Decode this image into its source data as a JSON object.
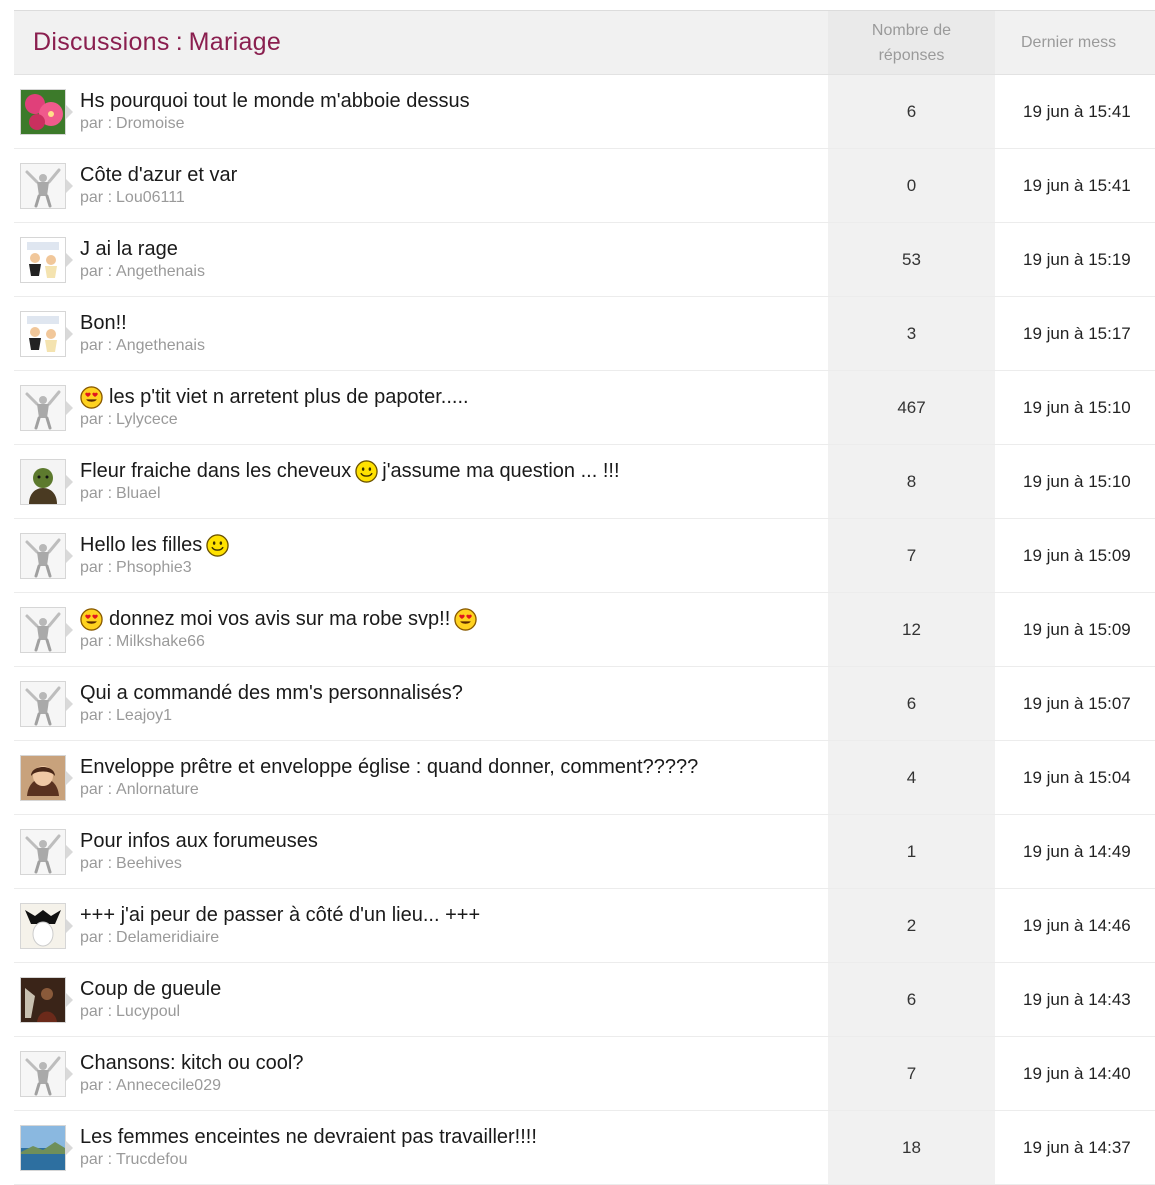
{
  "header": {
    "title_part1": "Discussions",
    "title_sep": ":",
    "title_part2": "Mariage",
    "replies_line1": "Nombre de",
    "replies_line2": "réponses",
    "last_label": "Dernier mess"
  },
  "author_prefix": "par :",
  "colors": {
    "title": "#8a1f4f",
    "muted": "#9a9a9a",
    "header_bg": "#f1f1f1"
  },
  "rows": [
    {
      "avatar": "pink-flower-avatar",
      "lead_emoji": null,
      "title": "Hs pourquoi tout le monde m'abboie dessus",
      "mid_emoji": null,
      "title_after": "",
      "end_emoji": null,
      "author": "Dromoise",
      "replies": "6",
      "last": "19 jun à 15:41"
    },
    {
      "avatar": "default-silhouette-avatar",
      "lead_emoji": null,
      "title": "Côte d'azur et var",
      "mid_emoji": null,
      "title_after": "",
      "end_emoji": null,
      "author": "Lou06111",
      "replies": "0",
      "last": "19 jun à 15:41"
    },
    {
      "avatar": "cartoon-couple-avatar",
      "lead_emoji": null,
      "title": "J ai la rage",
      "mid_emoji": null,
      "title_after": "",
      "end_emoji": null,
      "author": "Angethenais",
      "replies": "53",
      "last": "19 jun à 15:19"
    },
    {
      "avatar": "cartoon-couple-avatar",
      "lead_emoji": null,
      "title": "Bon!!",
      "mid_emoji": null,
      "title_after": "",
      "end_emoji": null,
      "author": "Angethenais",
      "replies": "3",
      "last": "19 jun à 15:17"
    },
    {
      "avatar": "default-silhouette-avatar",
      "lead_emoji": "heart-eyes",
      "title": "les p'tit viet n arretent plus de papoter.....",
      "mid_emoji": null,
      "title_after": "",
      "end_emoji": null,
      "author": "Lylycece",
      "replies": "467",
      "last": "19 jun à 15:10"
    },
    {
      "avatar": "green-ogre-avatar",
      "lead_emoji": null,
      "title": "Fleur fraiche dans les cheveux",
      "mid_emoji": "smile",
      "title_after": "j'assume ma question ... !!!",
      "end_emoji": null,
      "author": "Bluael",
      "replies": "8",
      "last": "19 jun à 15:10"
    },
    {
      "avatar": "default-silhouette-avatar",
      "lead_emoji": null,
      "title": "Hello les filles",
      "mid_emoji": null,
      "title_after": "",
      "end_emoji": "smile",
      "author": "Phsophie3",
      "replies": "7",
      "last": "19 jun à 15:09"
    },
    {
      "avatar": "default-silhouette-avatar",
      "lead_emoji": "heart-eyes",
      "title": "donnez moi vos avis sur ma robe svp!!",
      "mid_emoji": null,
      "title_after": "",
      "end_emoji": "heart-eyes",
      "author": "Milkshake66",
      "replies": "12",
      "last": "19 jun à 15:09"
    },
    {
      "avatar": "default-silhouette-avatar",
      "lead_emoji": null,
      "title": "Qui a commandé des mm's personnalisés?",
      "mid_emoji": null,
      "title_after": "",
      "end_emoji": null,
      "author": "Leajoy1",
      "replies": "6",
      "last": "19 jun à 15:07"
    },
    {
      "avatar": "woman-portrait-avatar",
      "lead_emoji": null,
      "title": "Enveloppe prêtre et enveloppe église : quand donner, comment?????",
      "mid_emoji": null,
      "title_after": "",
      "end_emoji": null,
      "author": "Anlornature",
      "replies": "4",
      "last": "19 jun à 15:04"
    },
    {
      "avatar": "default-silhouette-avatar",
      "lead_emoji": null,
      "title": "Pour infos aux forumeuses",
      "mid_emoji": null,
      "title_after": "",
      "end_emoji": null,
      "author": "Beehives",
      "replies": "1",
      "last": "19 jun à 14:49"
    },
    {
      "avatar": "penguin-avatar",
      "lead_emoji": null,
      "title": "+++ j'ai peur de passer à côté d'un lieu... +++",
      "mid_emoji": null,
      "title_after": "",
      "end_emoji": null,
      "author": "Delameridiaire",
      "replies": "2",
      "last": "19 jun à 14:46"
    },
    {
      "avatar": "dark-photo-avatar",
      "lead_emoji": null,
      "title": "Coup de gueule",
      "mid_emoji": null,
      "title_after": "",
      "end_emoji": null,
      "author": "Lucypoul",
      "replies": "6",
      "last": "19 jun à 14:43"
    },
    {
      "avatar": "default-silhouette-avatar",
      "lead_emoji": null,
      "title": "Chansons: kitch ou cool?",
      "mid_emoji": null,
      "title_after": "",
      "end_emoji": null,
      "author": "Annececile029",
      "replies": "7",
      "last": "19 jun à 14:40"
    },
    {
      "avatar": "landscape-avatar",
      "lead_emoji": null,
      "title": "Les femmes enceintes ne devraient pas travailler!!!!",
      "mid_emoji": null,
      "title_after": "",
      "end_emoji": null,
      "author": "Trucdefou",
      "replies": "18",
      "last": "19 jun à 14:37"
    }
  ]
}
